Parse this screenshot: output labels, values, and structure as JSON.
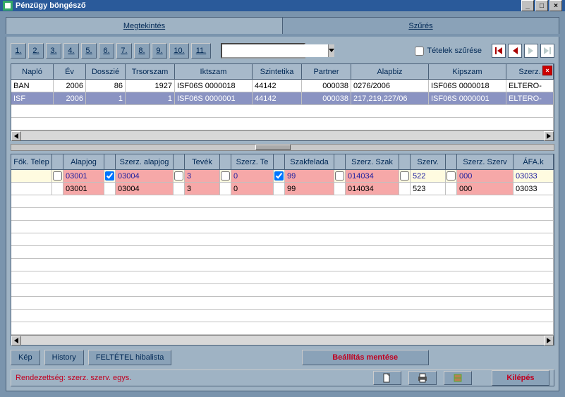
{
  "titlebar": {
    "title": "Pénzügy böngésző"
  },
  "tabs": {
    "view": "Megtekintés",
    "filter": "Szűrés"
  },
  "number_buttons": [
    "1.",
    "2.",
    "3.",
    "4.",
    "5.",
    "6.",
    "7.",
    "8.",
    "9.",
    "10.",
    "11."
  ],
  "filter_checkbox": "Tételek szűrése",
  "grid1": {
    "headers": [
      "Napló",
      "Év",
      "Dosszié",
      "Trsorszam",
      "Iktszam",
      "Szintetika",
      "Partner",
      "Alapbiz",
      "Kipszam",
      "Szerz."
    ],
    "rows": [
      {
        "naplo": "BAN",
        "ev": "2006",
        "dosszie": "86",
        "trsor": "1927",
        "iktszam": "ISF06S 0000018",
        "szint": "44142",
        "partner": "000038",
        "alapbiz": "0276/2006",
        "kipszam": "ISF06S 0000018",
        "szerz": "ELTERO-"
      },
      {
        "naplo": "ISF",
        "ev": "2006",
        "dosszie": "1",
        "trsor": "1",
        "iktszam": "ISF06S 0000001",
        "szint": "44142",
        "partner": "000038",
        "alapbiz": "217,219,227/06",
        "kipszam": "ISF06S 0000001",
        "szerz": "ELTERO-"
      }
    ]
  },
  "grid2": {
    "headers": [
      "Fők. Telep",
      "Alapjog",
      "Szerz. alapjog",
      "Tevék",
      "Szerz. Te",
      "Szakfelada",
      "Szerz. Szak",
      "Szerv.",
      "Szerz. Szerv",
      "ÁFA.k"
    ],
    "rows": [
      {
        "chk": [
          false,
          true,
          false,
          false,
          true,
          false,
          false,
          false
        ],
        "cells": [
          "03001",
          "03004",
          "3",
          "0",
          "99",
          "014034",
          "522",
          "000",
          "03033"
        ]
      },
      {
        "chk": null,
        "cells": [
          "03001",
          "03004",
          "3",
          "0",
          "99",
          "014034",
          "523",
          "000",
          "03033"
        ]
      }
    ]
  },
  "buttons": {
    "kep": "Kép",
    "history": "History",
    "feltetel": "FELTÉTEL hibalista",
    "beallitas": "Beállítás mentése",
    "kilepes": "Kilépés"
  },
  "status": "Rendezettség:  szerz. szerv. egys."
}
